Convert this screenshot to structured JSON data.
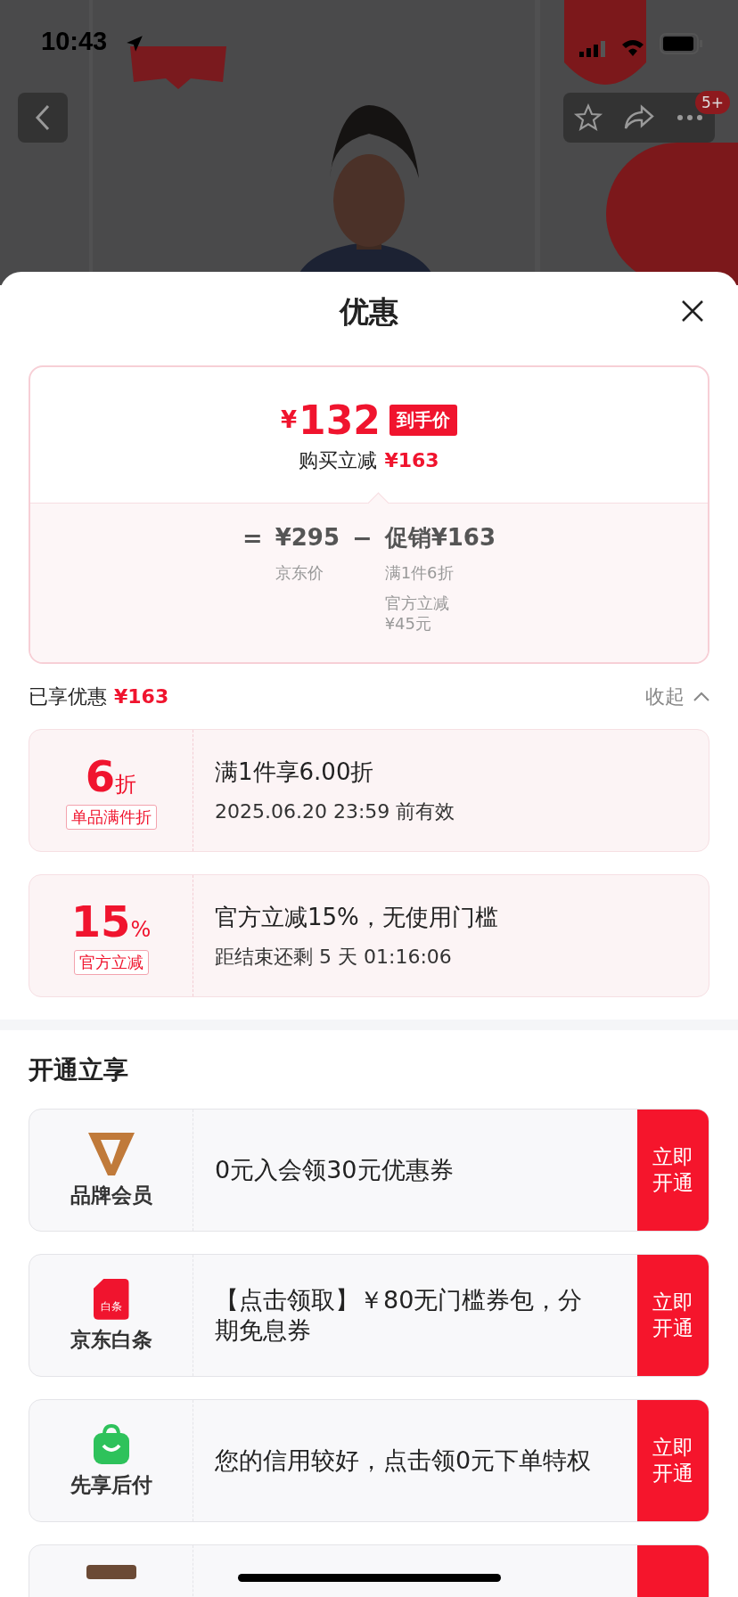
{
  "status_bar": {
    "time": "10:43"
  },
  "top_bar": {
    "badge": "5+"
  },
  "sheet": {
    "title": "优惠"
  },
  "price_card": {
    "currency": "¥",
    "price": "132",
    "price_tag": "到手价",
    "saving_label": "购买立减",
    "saving_value": "¥163",
    "formula": {
      "equals": "=",
      "base_price": "¥295",
      "minus": "−",
      "promo": "促销¥163",
      "base_caption": "京东价",
      "promo_notes": [
        "满1件6折",
        "官方立减\n¥45元"
      ]
    }
  },
  "summary": {
    "label": "已享优惠",
    "value": "¥163",
    "toggle": "收起",
    "expanded": true
  },
  "coupons": [
    {
      "amount": "6",
      "unit": "折",
      "tag": "单品满件折",
      "title": "满1件享6.00折",
      "detail": "2025.06.20 23:59 前有效"
    },
    {
      "amount": "15",
      "unit": "%",
      "tag": "官方立减",
      "title": "官方立减15%，无使用门槛",
      "detail": "距结束还剩 5 天 01:16:06"
    }
  ],
  "offers_section": {
    "title": "开通立享",
    "items": [
      {
        "kind": "member",
        "name": "品牌会员",
        "text": "0元入会领30元优惠券",
        "button": "立即开通"
      },
      {
        "kind": "credit",
        "icon_label": "白条",
        "name": "京东白条",
        "text": "【点击领取】￥80无门槛券包，分期免息券",
        "button": "立即开通"
      },
      {
        "kind": "paylater",
        "name": "先享后付",
        "text": "您的信用较好，点击领0元下单特权",
        "button": "立即开通"
      },
      {
        "kind": "partial"
      }
    ]
  }
}
